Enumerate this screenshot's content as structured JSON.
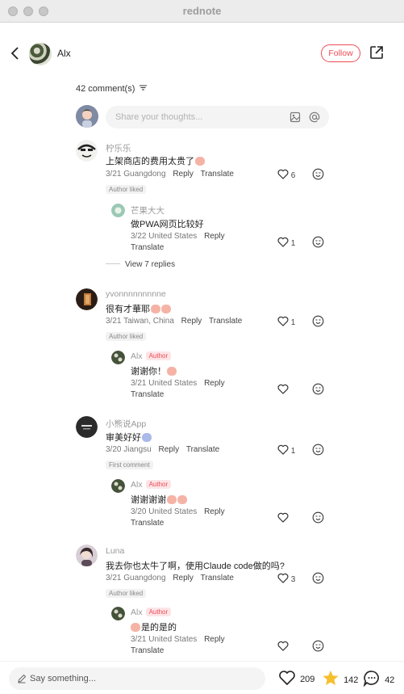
{
  "window": {
    "title": "rednote"
  },
  "header": {
    "author": "Alx",
    "follow_label": "Follow"
  },
  "comments_header": {
    "count_label": "42 comment(s)"
  },
  "composer": {
    "placeholder": "Share your thoughts..."
  },
  "comments": [
    {
      "user": "柠乐乐",
      "text": "上架商店的费用太贵了",
      "date": "3/21",
      "location": "Guangdong",
      "reply_label": "Reply",
      "translate_label": "Translate",
      "likes": "6",
      "badge": "Author liked",
      "replies": [
        {
          "user": "芒果大大",
          "text": "做PWA网页比较好",
          "date": "3/22",
          "location": "United States",
          "reply_label": "Reply",
          "translate_label": "Translate",
          "likes": "1"
        }
      ],
      "view_more": "View 7 replies"
    },
    {
      "user": "yvonnnnnnnnne",
      "text": "很有才華耶",
      "date": "3/21",
      "location": "Taiwan, China",
      "reply_label": "Reply",
      "translate_label": "Translate",
      "likes": "1",
      "badge": "Author liked",
      "replies": [
        {
          "user": "Alx",
          "tag": "Author",
          "text": "谢谢你！",
          "date": "3/21",
          "location": "United States",
          "reply_label": "Reply",
          "translate_label": "Translate",
          "likes": ""
        }
      ]
    },
    {
      "user": "小熊说App",
      "text": "审美好好",
      "date": "3/20",
      "location": "Jiangsu",
      "reply_label": "Reply",
      "translate_label": "Translate",
      "likes": "1",
      "badge": "First comment",
      "replies": [
        {
          "user": "Alx",
          "tag": "Author",
          "text": "谢谢谢谢",
          "date": "3/20",
          "location": "United States",
          "reply_label": "Reply",
          "translate_label": "Translate",
          "likes": ""
        }
      ]
    },
    {
      "user": "Luna",
      "text": "我去你也太牛了啊，使用Claude code做的吗?",
      "date": "3/21",
      "location": "Guangdong",
      "reply_label": "Reply",
      "translate_label": "Translate",
      "likes": "3",
      "badge": "Author liked",
      "replies": [
        {
          "user": "Alx",
          "tag": "Author",
          "text": "是的是的",
          "date": "3/21",
          "location": "United States",
          "reply_label": "Reply",
          "translate_label": "Translate",
          "likes": ""
        }
      ]
    }
  ],
  "bottom_bar": {
    "placeholder": "Say something...",
    "likes": "209",
    "collects": "142",
    "comments": "42"
  },
  "colors": {
    "accent": "#ee4b55",
    "star": "#f5c02e"
  }
}
